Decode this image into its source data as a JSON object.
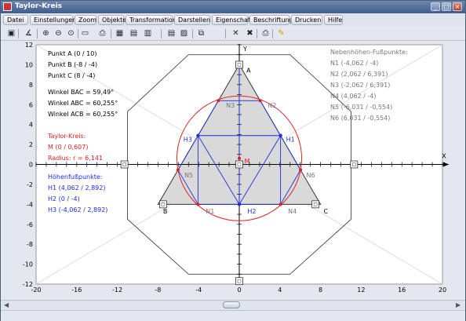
{
  "window": {
    "title": "Taylor-Kreis"
  },
  "menu": [
    "Datei",
    "Einstellungen",
    "Zoom",
    "Objekte",
    "Transformation",
    "Darstellen",
    "Eigenschaft",
    "Beschriftung",
    "Drucken",
    "Hilfe"
  ],
  "toolbar": [
    "save-icon",
    "angle-icon",
    "zoom-in-icon",
    "zoom-out-icon",
    "zoom-fit-icon",
    "window-icon",
    "print-icon",
    "grid-icon",
    "grid-icon-2",
    "grid-icon-3",
    "table-icon",
    "chart-icon",
    "copy-icon",
    "cross-icon",
    "cross-icon-2",
    "printer-icon",
    "pin-icon"
  ],
  "info_left": {
    "points": [
      "Punkt A (0 / 10)",
      "Punkt B (-8 / -4)",
      "Punkt C (8 / -4)"
    ],
    "angles": [
      "Winkel BAC = 59,49°",
      "Winkel ABC = 60,255°",
      "Winkel ACB = 60,255°"
    ],
    "taylor": [
      "Taylor-Kreis:",
      "M (0 / 0,607)",
      "Radius: r = 6,141"
    ],
    "heights": [
      "Höhenfußpunkte:",
      "H1 (4,062 / 2,892)",
      "H2 (0 / -4)",
      "H3 (-4,062 / 2,892)"
    ]
  },
  "info_right": [
    "Nebenhöhen-Fußpunkte:",
    "N1 (-4,062 / -4)",
    "N2 (2,062 / 6,391)",
    "N3 (-2,062 / 6,391)",
    "N4 (4,062 / -4)",
    "N5 (-6,031 / -0,554)",
    "N6 (6,031 / -0,554)"
  ],
  "colors": {
    "red": "#e02020",
    "blue": "#1e2edc",
    "gray": "#777777",
    "fill": "#d9d9d9"
  },
  "chart_data": {
    "type": "scatter",
    "xlim": [
      -20,
      20
    ],
    "ylim": [
      -12,
      12
    ],
    "xticks": [
      -20,
      -16,
      -12,
      -8,
      -4,
      0,
      4,
      8,
      12,
      16,
      20
    ],
    "yticks": [
      -12,
      -10,
      -8,
      -6,
      -4,
      -2,
      0,
      2,
      4,
      6,
      8,
      10,
      12
    ],
    "xlabel": "X",
    "ylabel": "Y",
    "triangle": {
      "A": [
        0,
        10
      ],
      "B": [
        -8,
        -4
      ],
      "C": [
        8,
        -4
      ]
    },
    "heights": {
      "H1": [
        4.062,
        2.892
      ],
      "H2": [
        0,
        -4
      ],
      "H3": [
        -4.062,
        2.892
      ]
    },
    "footpoints": {
      "N1": [
        -4.062,
        -4
      ],
      "N2": [
        2.062,
        6.391
      ],
      "N3": [
        -2.062,
        6.391
      ],
      "N4": [
        4.062,
        -4
      ],
      "N5": [
        -6.031,
        -0.554
      ],
      "N6": [
        6.031,
        -0.554
      ]
    },
    "circle": {
      "M": [
        0,
        0.607
      ],
      "r": 6.141
    },
    "octagon": [
      [
        -5,
        11
      ],
      [
        5,
        11
      ],
      [
        11,
        5.3
      ],
      [
        11,
        -5.5
      ],
      [
        5,
        -11
      ],
      [
        -5,
        -11
      ],
      [
        -11,
        -5.5
      ],
      [
        -11,
        5.3
      ]
    ],
    "handles": [
      [
        0,
        10
      ],
      [
        0,
        -11.7
      ],
      [
        -11.3,
        0
      ],
      [
        11.3,
        0
      ],
      [
        0,
        0
      ],
      [
        -7.5,
        -4
      ],
      [
        7.5,
        -4
      ]
    ],
    "labels": {
      "A": "A",
      "B": "B",
      "C": "C",
      "M": "M",
      "H1": "H1",
      "H2": "H2",
      "H3": "H3",
      "N1": "N1",
      "N2": "N2",
      "N3": "N3",
      "N4": "N4",
      "N5": "N5",
      "N6": "N6"
    }
  }
}
